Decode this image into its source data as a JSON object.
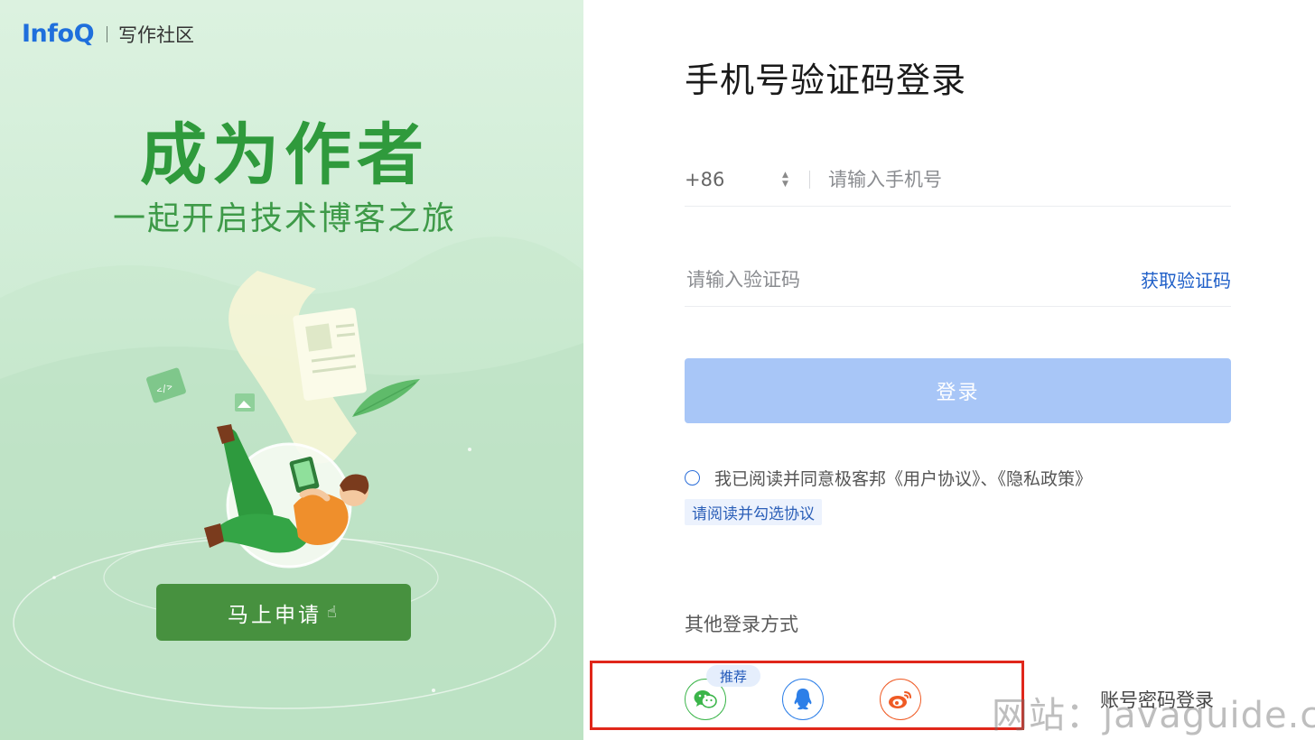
{
  "promo": {
    "brand_logo": "InfoQ",
    "brand_subtitle": "写作社区",
    "title": "成为作者",
    "subtitle": "一起开启技术博客之旅",
    "apply_button": "马上申请",
    "colors": {
      "accent": "#2f9a3c",
      "button": "#47913f"
    }
  },
  "login": {
    "title": "手机号验证码登录",
    "country_code": "+86",
    "phone_placeholder": "请输入手机号",
    "code_placeholder": "请输入验证码",
    "get_code": "获取验证码",
    "submit": "登录",
    "agreement": {
      "prefix": "我已阅读并同意极客邦",
      "user_agreement": "《用户协议》",
      "separator": "、",
      "privacy_policy": "《隐私政策》"
    },
    "agree_hint": "请阅读并勾选协议",
    "other_methods_title": "其他登录方式",
    "recommended_badge": "推荐",
    "social": [
      {
        "name": "wechat-icon",
        "color": "#3bb54a"
      },
      {
        "name": "qq-icon",
        "color": "#2d7fe8"
      },
      {
        "name": "weibo-icon",
        "color": "#ef5a24"
      }
    ],
    "account_login": "账号密码登录",
    "colors": {
      "primary_disabled": "#a8c6f7",
      "link": "#1f5fc8",
      "highlight_box": "#e0271a"
    }
  },
  "watermark": "网站：javaguide.cn"
}
